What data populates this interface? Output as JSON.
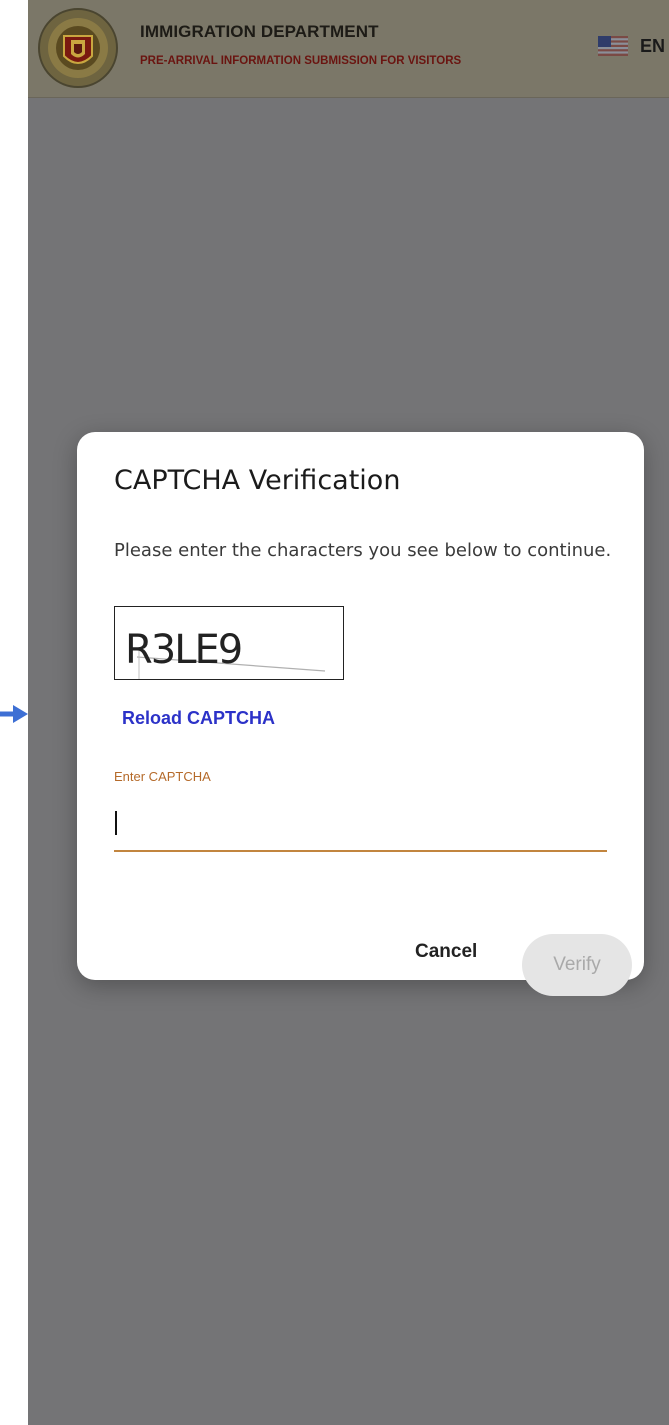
{
  "header": {
    "title": "IMMIGRATION DEPARTMENT",
    "subtitle": "PRE-ARRIVAL INFORMATION SUBMISSION FOR VISITORS",
    "language_label": "EN",
    "logo_text": "QUẢN LÝ XUẤT NHẬP CẢNH IMMIGRATION"
  },
  "dialog": {
    "title": "CAPTCHA Verification",
    "message": "Please enter the characters you see below to continue.",
    "captcha_text": "R3LE9",
    "reload_label": "Reload CAPTCHA",
    "input_label": "Enter CAPTCHA",
    "input_value": "",
    "cancel_label": "Cancel",
    "verify_label": "Verify"
  },
  "colors": {
    "overlay": "#747476",
    "header_bg": "#7b7768",
    "subtitle": "#6a1410",
    "link": "#2c32c8",
    "field_label": "#b56a2a",
    "input_underline": "#c2853f",
    "verify_disabled_bg": "#e5e5e5",
    "arrow": "#3d6fd4"
  },
  "icons": [
    "arrow-right-icon",
    "immigration-seal-logo",
    "us-flag-icon"
  ]
}
